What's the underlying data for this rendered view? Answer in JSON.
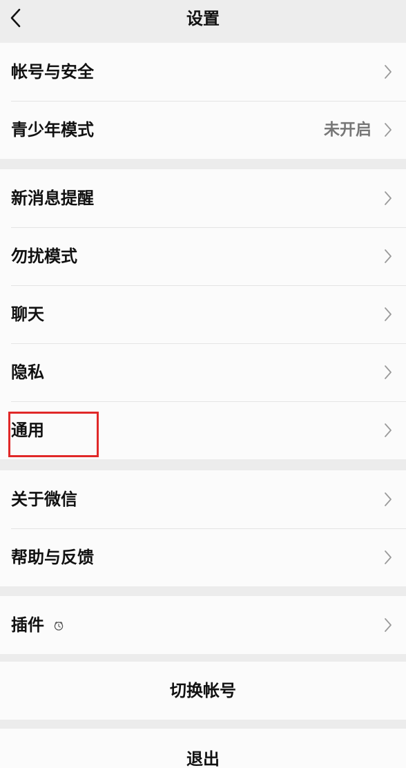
{
  "navbar": {
    "title": "设置",
    "back_icon": "chevron-left-icon"
  },
  "groups": [
    {
      "items": [
        {
          "label": "帐号与安全"
        },
        {
          "label": "青少年模式",
          "value": "未开启"
        }
      ]
    },
    {
      "items": [
        {
          "label": "新消息提醒"
        },
        {
          "label": "勿扰模式"
        },
        {
          "label": "聊天"
        },
        {
          "label": "隐私"
        },
        {
          "label": "通用"
        }
      ]
    },
    {
      "items": [
        {
          "label": "关于微信"
        },
        {
          "label": "帮助与反馈"
        }
      ]
    },
    {
      "items": [
        {
          "label": "插件",
          "icon": "plugin-icon"
        }
      ]
    }
  ],
  "actions": {
    "switch_account": "切换帐号",
    "logout": "退出"
  },
  "colors": {
    "background": "#ececec",
    "row_background": "#fbfbfb",
    "highlight": "#e02828"
  }
}
